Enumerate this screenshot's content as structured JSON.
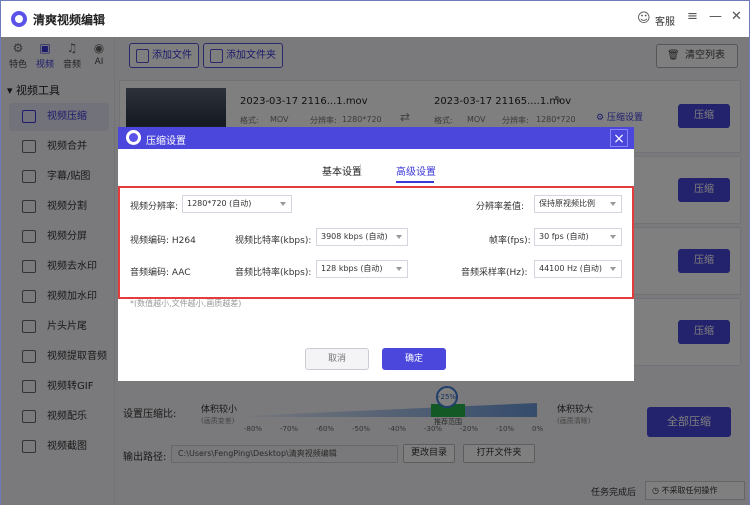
{
  "app": {
    "title": "清爽视频编辑",
    "service": "客服"
  },
  "sidebar": {
    "tabs": [
      "特色",
      "视频",
      "音频",
      "AI"
    ],
    "category": "视频工具",
    "items": [
      "视频压缩",
      "视频合并",
      "字幕/贴图",
      "视频分割",
      "视频分屏",
      "视频去水印",
      "视频加水印",
      "片头片尾",
      "视频提取音频",
      "视频转GIF",
      "视频配乐",
      "视频截图"
    ]
  },
  "toolbar": {
    "add_file": "添加文件",
    "add_folder": "添加文件夹",
    "clear_list": "清空列表"
  },
  "file": {
    "src_name": "2023-03-17 2116...1.mov",
    "dst_name": "2023-03-17 21165....1.mov",
    "format_label": "格式:",
    "format_val": "MOV",
    "res_label": "分辨率:",
    "res_val": "1280*720",
    "settings_link": "压缩设置",
    "compress": "压缩",
    "side_link": "设置"
  },
  "bottom": {
    "ratio_label": "设置压缩比:",
    "small_label": "体积较小",
    "small_sub": "(画质变差)",
    "big_label": "体积较大",
    "big_sub": "(画质清晰)",
    "badge": "-25%",
    "recommend": "推荐范围",
    "ticks": [
      "-80%",
      "-70%",
      "-60%",
      "-50%",
      "-40%",
      "-30%",
      "-20%",
      "-10%",
      "0%"
    ],
    "ratio_level_pct": -25,
    "all_compress": "全部压缩",
    "output_label": "输出路径:",
    "output_path": "C:\\Users\\FengPing\\Desktop\\清爽视频编辑",
    "change_dir": "更改目录",
    "open_folder": "打开文件夹"
  },
  "status": {
    "after_label": "任务完成后",
    "after_value": "不采取任何操作"
  },
  "dialog": {
    "title": "压缩设置",
    "tab_basic": "基本设置",
    "tab_adv": "高级设置",
    "res_label": "视频分辨率:",
    "res_val": "1280*720 (自动)",
    "interp_label": "分辨率差值:",
    "interp_val": "保持原视频比例",
    "vcodec": "视频编码: H264",
    "vbit_label": "视频比特率(kbps):",
    "vbit_val": "3908 kbps (自动)",
    "fps_label": "帧率(fps):",
    "fps_val": "30 fps (自动)",
    "acodec": "音频编码: AAC",
    "abit_label": "音频比特率(kbps):",
    "abit_val": "128 kbps (自动)",
    "rate_label": "音频采样率(Hz):",
    "rate_val": "44100 Hz (自动)",
    "note": "*(数值越小,文件越小,画质越差)",
    "cancel": "取消",
    "ok": "确定"
  }
}
